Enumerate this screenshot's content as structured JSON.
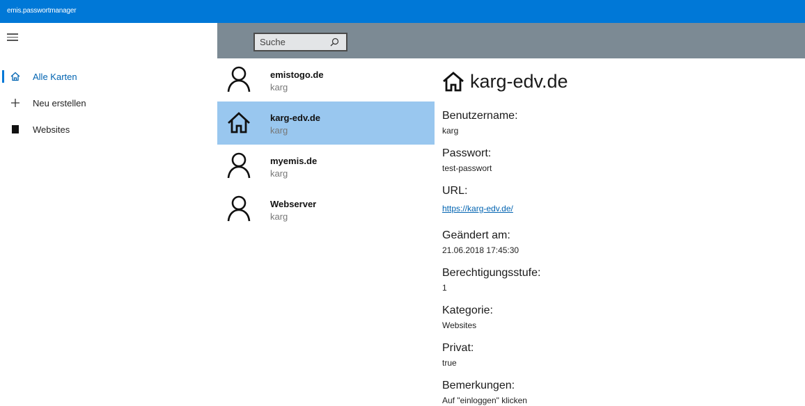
{
  "app": {
    "title": "emis.passwortmanager"
  },
  "nav": {
    "items": [
      {
        "label": "Alle Karten",
        "icon": "home-icon",
        "active": true
      },
      {
        "label": "Neu erstellen",
        "icon": "plus-icon",
        "active": false
      },
      {
        "label": "Websites",
        "icon": "book-icon",
        "active": false
      }
    ]
  },
  "search": {
    "placeholder": "Suche"
  },
  "cards": [
    {
      "title": "emistogo.de",
      "user": "karg",
      "icon": "person-icon"
    },
    {
      "title": "karg-edv.de",
      "user": "karg",
      "icon": "home-icon",
      "selected": true
    },
    {
      "title": "myemis.de",
      "user": "karg",
      "icon": "person-icon"
    },
    {
      "title": "Webserver",
      "user": "karg",
      "icon": "person-icon"
    }
  ],
  "detail": {
    "title": "karg-edv.de",
    "fields": [
      {
        "label": "Benutzername:",
        "value": "karg"
      },
      {
        "label": "Passwort:",
        "value": "test-passwort"
      },
      {
        "label": "URL:",
        "value": "https://karg-edv.de/"
      },
      {
        "label": "Geändert am:",
        "value": "21.06.2018 17:45:30"
      },
      {
        "label": "Berechtigungsstufe:",
        "value": "1"
      },
      {
        "label": "Kategorie:",
        "value": "Websites"
      },
      {
        "label": "Privat:",
        "value": "true"
      },
      {
        "label": "Bemerkungen:",
        "value": "Auf \"einloggen\" klicken"
      }
    ]
  },
  "colors": {
    "accent": "#0078d7",
    "selection": "#99c7ef",
    "topbar": "#7c8a94"
  }
}
